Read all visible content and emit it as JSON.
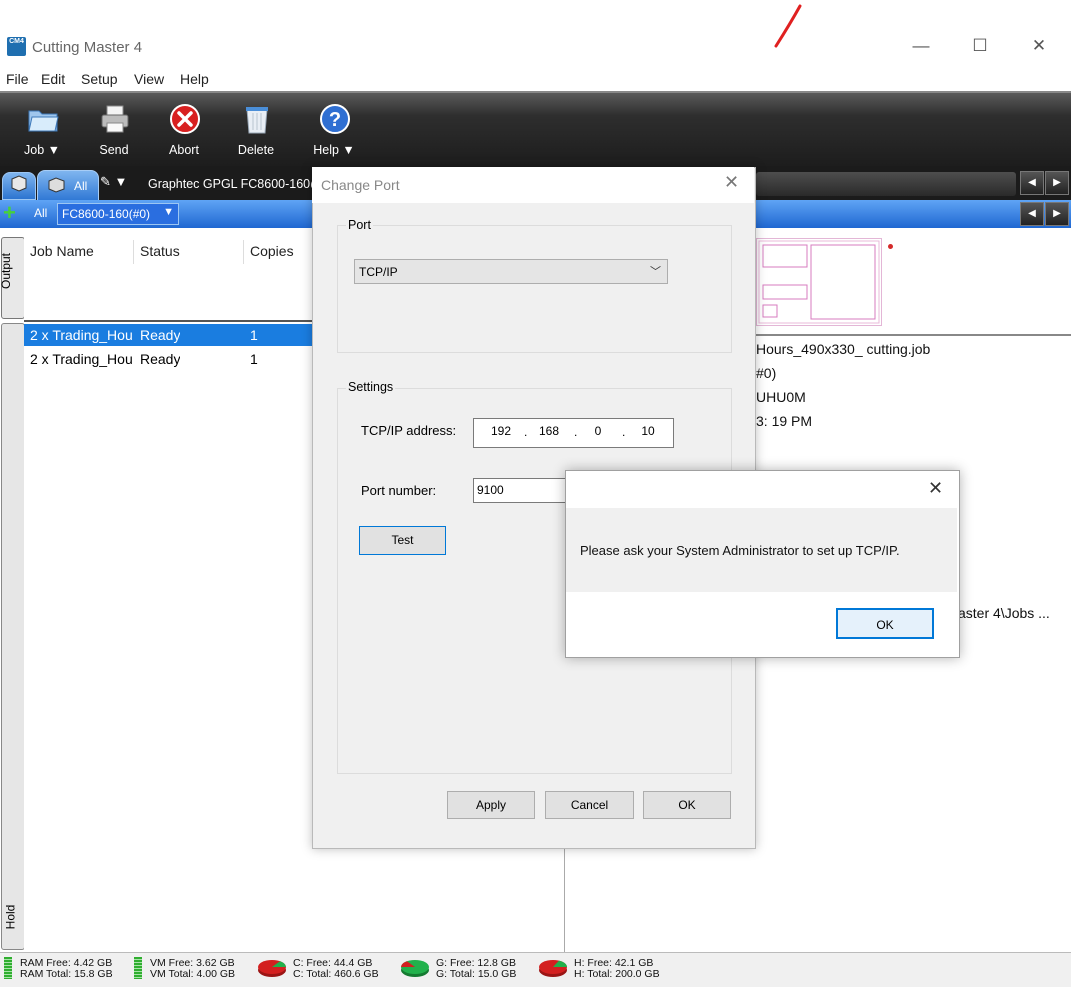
{
  "window": {
    "title": "Cutting Master 4",
    "icon_text": "CM4",
    "controls": {
      "minimize": "—",
      "maximize": "☐",
      "close": "✕"
    }
  },
  "menu": [
    "File",
    "Edit",
    "Setup",
    "View",
    "Help"
  ],
  "toolbar": {
    "job": "Job ▼",
    "send": "Send",
    "abort": "Abort",
    "delete": "Delete",
    "help": "Help ▼"
  },
  "tabs": {
    "all_label": "All",
    "pen": "✎ ▼",
    "device_tab": "Graphtec GPGL FC8600-160@"
  },
  "bluebar": {
    "all_label": "All",
    "device_select": "FC8600-160(#0)",
    "arrow": "▼"
  },
  "side_tabs": {
    "output": "Output",
    "hold": "Hold"
  },
  "job_table": {
    "columns": [
      "Job Name",
      "Status",
      "Copies"
    ],
    "rows": [
      {
        "name": "2 x Trading_Hou",
        "status": "Ready",
        "copies": "1"
      },
      {
        "name": "2 x Trading_Hou",
        "status": "Ready",
        "copies": "1"
      }
    ]
  },
  "right_panel": {
    "lines": [
      "Hours_490x330_ cutting.job",
      "#0)",
      "UHU0M",
      "3: 19 PM",
      "aster 4\\Jobs ..."
    ]
  },
  "change_port_dialog": {
    "title": "Change Port",
    "close": "✕",
    "port_group": "Port",
    "port_value": "TCP/IP",
    "settings_group": "Settings",
    "ip_label": "TCP/IP address:",
    "ip_octets": [
      "192",
      "168",
      "0",
      "10"
    ],
    "port_number_label": "Port number:",
    "port_number": "9100",
    "test": "Test",
    "apply": "Apply",
    "cancel": "Cancel",
    "ok": "OK"
  },
  "message_box": {
    "close": "✕",
    "text": "Please ask your System Administrator to set up TCP/IP.",
    "ok": "OK"
  },
  "status_bar": {
    "ram": [
      "RAM Free: 4.42 GB",
      "RAM Total: 15.8 GB"
    ],
    "vm": [
      "VM Free: 3.62 GB",
      "VM Total: 4.00 GB"
    ],
    "c_drive": [
      "C: Free: 44.4 GB",
      "C: Total: 460.6 GB"
    ],
    "g_drive": [
      "G: Free: 12.8 GB",
      "G: Total: 15.0 GB"
    ],
    "h_drive": [
      "H: Free: 42.1 GB",
      "H: Total: 200.0 GB"
    ]
  },
  "colors": {
    "accent": "#1a7de0",
    "toolbar_dark": "#1c1c1c",
    "abort_red": "#d82020",
    "disk_used_red": "#d32020",
    "disk_free_green": "#22b14c",
    "focus_blue": "#0078d7"
  }
}
